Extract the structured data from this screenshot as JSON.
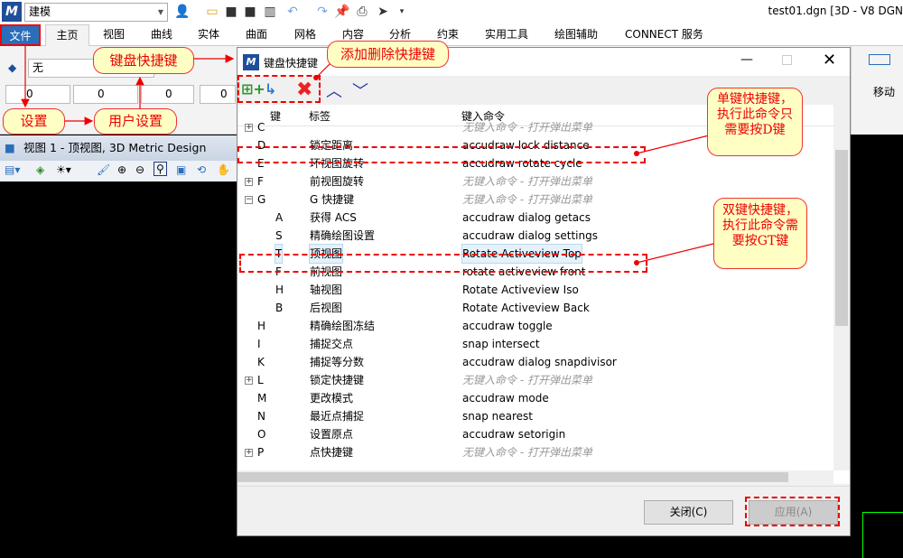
{
  "app": {
    "workflow": "建模",
    "document_title": "test01.dgn [3D - V8 DGN"
  },
  "tabs": [
    "文件",
    "主页",
    "视图",
    "曲线",
    "实体",
    "曲面",
    "网格",
    "内容",
    "分析",
    "约束",
    "实用工具",
    "绘图辅助",
    "CONNECT 服务"
  ],
  "ribbon": {
    "level_value": "无",
    "attr_values": [
      "0",
      "0",
      "0",
      "0"
    ],
    "move_label": "移动"
  },
  "view": {
    "title": "视图 1 - 顶视图, 3D Metric Design"
  },
  "dialog": {
    "title": "键盘快捷键",
    "columns": [
      "键",
      "标签",
      "键入命令"
    ],
    "rows": [
      {
        "exp": "+",
        "key": "C",
        "label": "",
        "cmd": "无键入命令 - 打开弹出菜单",
        "grey": true,
        "level": 0
      },
      {
        "exp": "",
        "key": "D",
        "label": "锁定距离",
        "cmd": "accudraw lock distance",
        "level": 0
      },
      {
        "exp": "",
        "key": "E",
        "label": "环视图旋转",
        "cmd": "accudraw rotate cycle",
        "level": 0
      },
      {
        "exp": "+",
        "key": "F",
        "label": "前视图旋转",
        "cmd": "无键入命令 - 打开弹出菜单",
        "grey": true,
        "level": 0
      },
      {
        "exp": "−",
        "key": "G",
        "label": "G 快捷键",
        "cmd": "无键入命令 - 打开弹出菜单",
        "grey": true,
        "level": 0
      },
      {
        "exp": "",
        "key": "A",
        "label": "获得 ACS",
        "cmd": "accudraw dialog getacs",
        "level": 1
      },
      {
        "exp": "",
        "key": "S",
        "label": "精确绘图设置",
        "cmd": "accudraw dialog settings",
        "level": 1
      },
      {
        "exp": "",
        "key": "T",
        "label": "顶视图",
        "cmd": "Rotate Activeview Top",
        "level": 1,
        "selected": true
      },
      {
        "exp": "",
        "key": "F",
        "label": "前视图",
        "cmd": "rotate activeview front",
        "level": 1
      },
      {
        "exp": "",
        "key": "H",
        "label": "轴视图",
        "cmd": "Rotate Activeview Iso",
        "level": 1
      },
      {
        "exp": "",
        "key": "B",
        "label": "后视图",
        "cmd": "Rotate Activeview Back",
        "level": 1
      },
      {
        "exp": "",
        "key": "H",
        "label": "精确绘图冻结",
        "cmd": "accudraw toggle",
        "level": 0
      },
      {
        "exp": "",
        "key": "I",
        "label": "捕捉交点",
        "cmd": "snap intersect",
        "level": 0
      },
      {
        "exp": "",
        "key": "K",
        "label": "捕捉等分数",
        "cmd": "accudraw dialog snapdivisor",
        "level": 0
      },
      {
        "exp": "+",
        "key": "L",
        "label": "锁定快捷键",
        "cmd": "无键入命令 - 打开弹出菜单",
        "grey": true,
        "level": 0
      },
      {
        "exp": "",
        "key": "M",
        "label": "更改模式",
        "cmd": "accudraw mode",
        "level": 0
      },
      {
        "exp": "",
        "key": "N",
        "label": "最近点捕捉",
        "cmd": "snap nearest",
        "level": 0
      },
      {
        "exp": "",
        "key": "O",
        "label": "设置原点",
        "cmd": "accudraw setorigin",
        "level": 0
      },
      {
        "exp": "+",
        "key": "P",
        "label": "点快捷键",
        "cmd": "无键入命令 - 打开弹出菜单",
        "grey": true,
        "level": 0
      }
    ],
    "close_label": "关闭(C)",
    "apply_label": "应用(A)"
  },
  "annotations": {
    "shortcuts": "键盘快捷键",
    "add_remove": "添加删除快捷键",
    "settings": "设置",
    "user_settings": "用户设置",
    "single": "单键快捷键，执行此命令只需要按D键",
    "double": "双键快捷键，执行此命令需要按GT键"
  },
  "colors": {
    "accent": "#2a6ebb",
    "annotation": "#e00000",
    "callout_bg": "#ffffc4"
  }
}
